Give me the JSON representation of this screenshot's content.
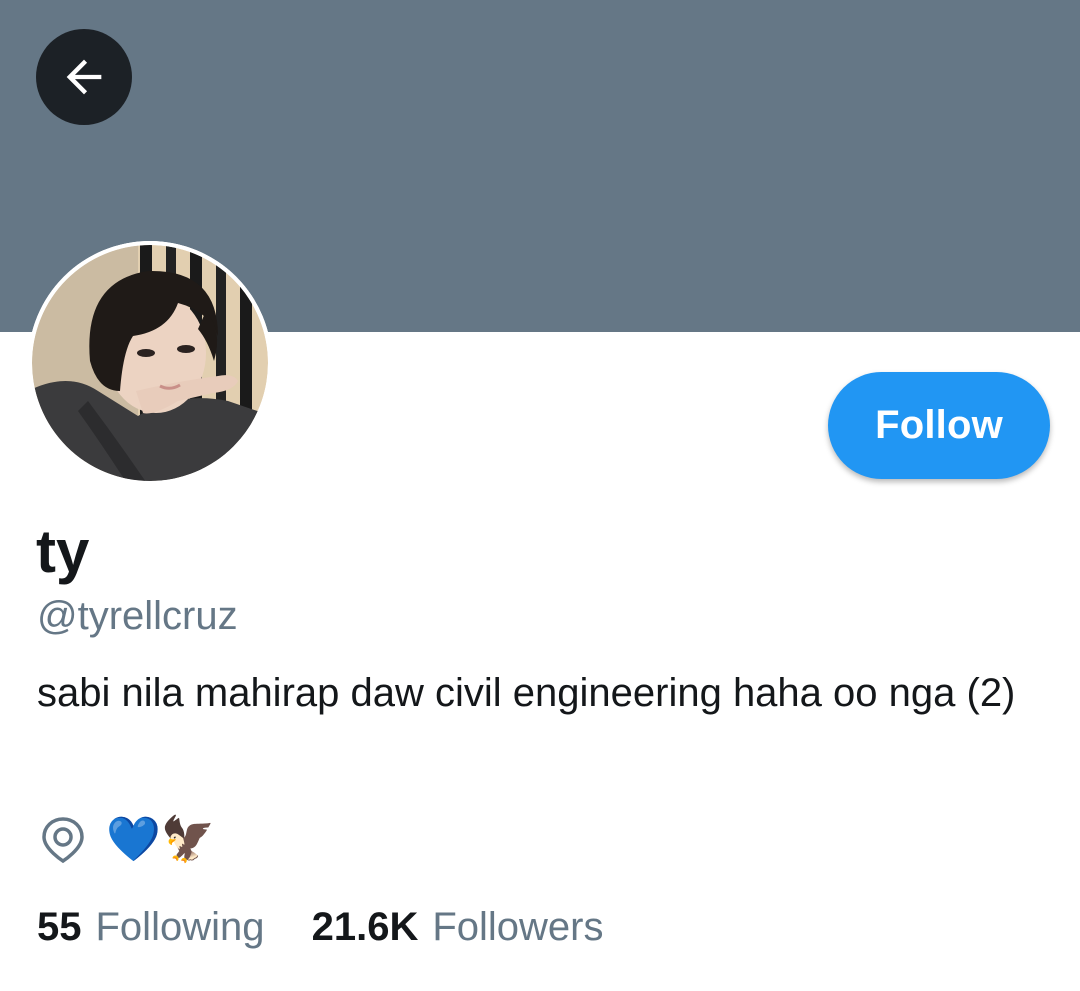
{
  "profile": {
    "display_name": "ty",
    "handle": "@tyrellcruz",
    "bio": "sabi nila mahirap daw civil engineering haha oo nga (2)",
    "location_text": "💙🦅",
    "follow_button_label": "Follow",
    "back_icon": "arrow-left-icon",
    "location_icon": "location-pin-icon"
  },
  "stats": {
    "following_count": "55",
    "following_label": "Following",
    "followers_count": "21.6K",
    "followers_label": "Followers"
  },
  "colors": {
    "banner": "#657786",
    "accent": "#2196f3",
    "text_primary": "#14171a",
    "text_secondary": "#657786"
  }
}
